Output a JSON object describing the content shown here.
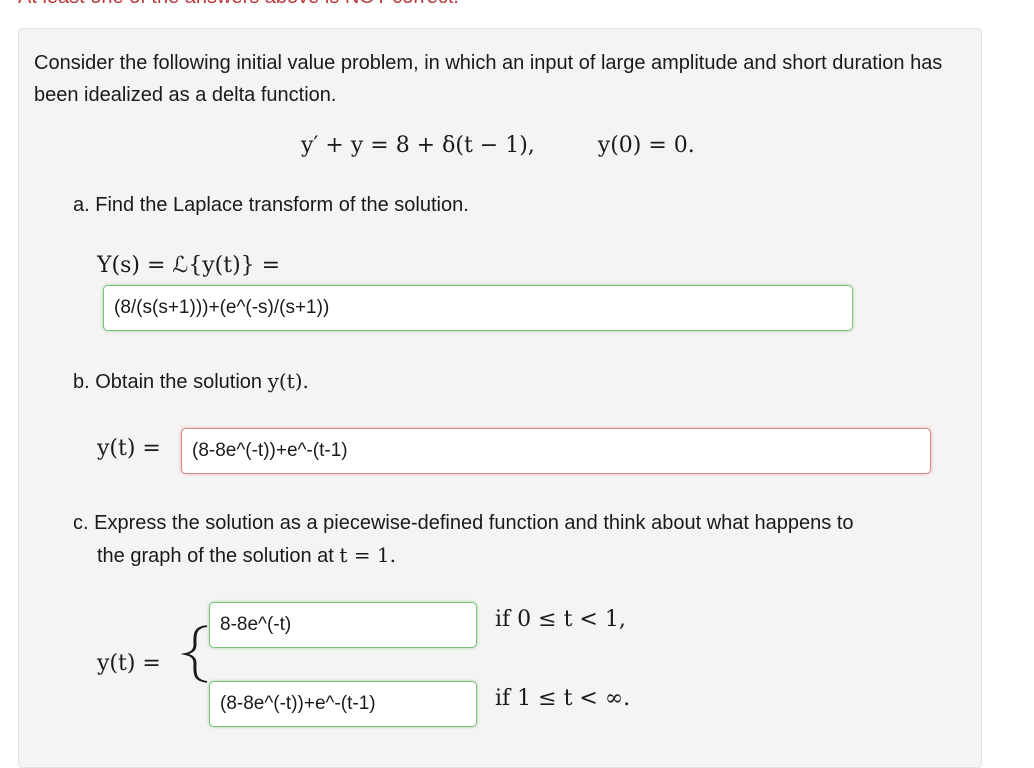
{
  "banner": "At least one of the answers above is NOT correct.",
  "intro": "Consider the following initial value problem, in which an input of large amplitude and short duration has been idealized as a delta function.",
  "equation": {
    "ode": "y′ + y = 8 + δ(t − 1),",
    "initial_condition": "y(0) = 0."
  },
  "part_a": {
    "question": "a. Find the Laplace transform of the solution.",
    "label": "Y(s) = ℒ{y(t)} =",
    "answer": "(8/(s(s+1)))+(e^(-s)/(s+1))",
    "status": "correct"
  },
  "part_b": {
    "question_text": "b. Obtain the solution ",
    "question_math": "y(t).",
    "label": "y(t) =",
    "answer": "(8-8e^(-t))+e^-(t-1)",
    "status": "incorrect"
  },
  "part_c": {
    "question_line1": "c. Express the solution as a piecewise-defined function and think about what happens to",
    "question_line2_text": "the graph of the solution at ",
    "question_line2_math": "t = 1.",
    "label": "y(t) =",
    "piece1": {
      "answer": "8-8e^(-t)",
      "condition": "if  0 ≤ t < 1,",
      "status": "correct"
    },
    "piece2": {
      "answer": "(8-8e^(-t))+e^-(t-1)",
      "condition": "if  1 ≤ t < ∞.",
      "status": "correct"
    }
  },
  "colors": {
    "correct": "#5cb85c",
    "incorrect": "#d9534f",
    "panel_background": "#f4f4f4"
  }
}
